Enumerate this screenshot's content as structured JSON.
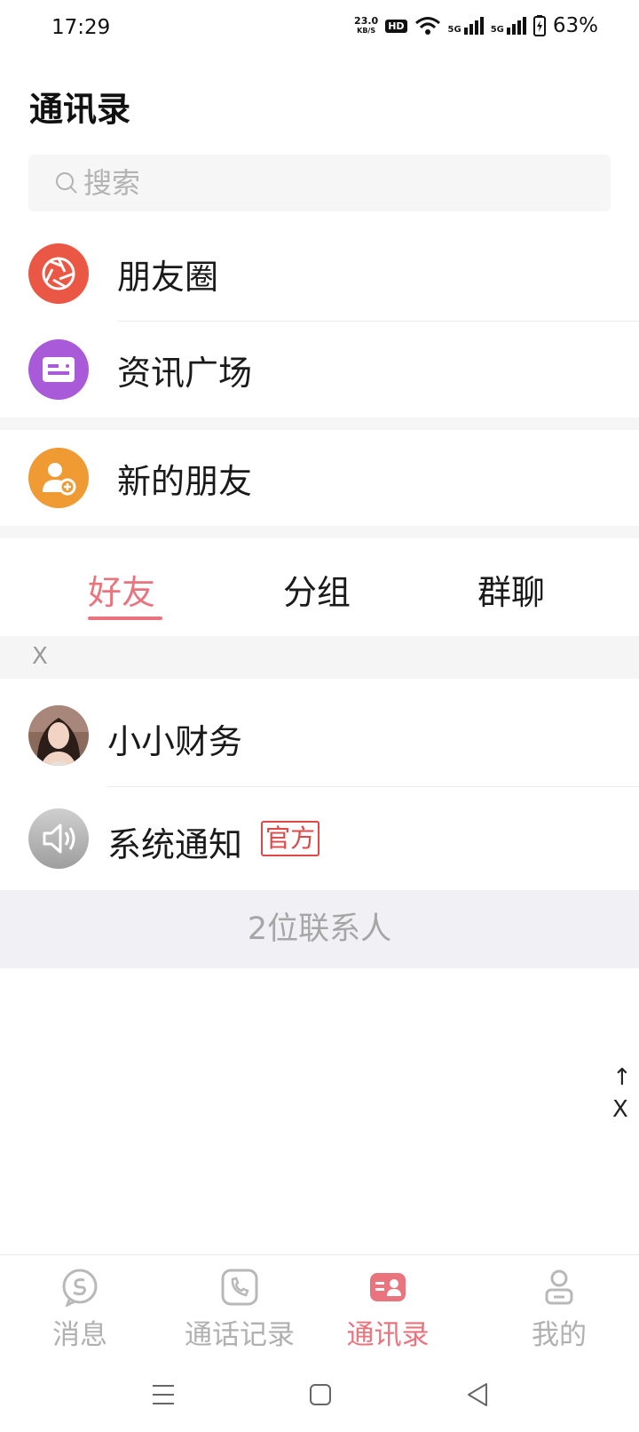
{
  "status_bar": {
    "time": "17:29",
    "net_speed": "23.0",
    "net_unit": "KB/S",
    "hd": "HD",
    "signal_1": "5G",
    "signal_2": "5G",
    "battery": "63%"
  },
  "header": {
    "title": "通讯录"
  },
  "search": {
    "placeholder": "搜索"
  },
  "entries": [
    {
      "label": "朋友圈",
      "icon": "camera-aperture-icon",
      "color": "#ea5744"
    },
    {
      "label": "资讯广场",
      "icon": "news-card-icon",
      "color": "#a95ad8"
    },
    {
      "label": "新的朋友",
      "icon": "add-friend-icon",
      "color": "#ef9a33"
    }
  ],
  "tabs": [
    {
      "label": "好友",
      "active": true
    },
    {
      "label": "分组",
      "active": false
    },
    {
      "label": "群聊",
      "active": false
    }
  ],
  "section_letter": "X",
  "contacts": [
    {
      "name": "小小财务",
      "avatar": "user-photo-avatar"
    },
    {
      "name": "系统通知",
      "badge": "官方",
      "avatar": "speaker-icon"
    }
  ],
  "contact_count": "2位联系人",
  "alphabet_index": {
    "arrow": "↑",
    "letter": "X"
  },
  "bottom_nav": [
    {
      "label": "消息",
      "icon": "message-icon",
      "active": false
    },
    {
      "label": "通话记录",
      "icon": "phone-icon",
      "active": false
    },
    {
      "label": "通讯录",
      "icon": "contacts-icon",
      "active": true
    },
    {
      "label": "我的",
      "icon": "profile-icon",
      "active": false
    }
  ],
  "colors": {
    "accent": "#e9747d",
    "official": "#e04848"
  }
}
